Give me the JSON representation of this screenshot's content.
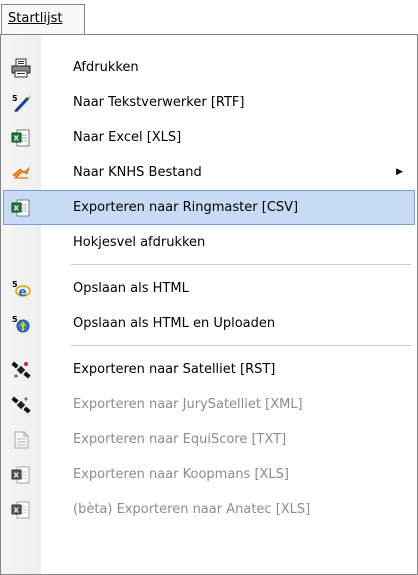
{
  "menu": {
    "title": "Startlijst"
  },
  "items": [
    {
      "label": "Afdrukken",
      "icon": "printer-icon"
    },
    {
      "label": "Naar Tekstverwerker [RTF]",
      "icon": "text-editor-icon"
    },
    {
      "label": "Naar Excel [XLS]",
      "icon": "excel-icon"
    },
    {
      "label": "Naar KNHS Bestand",
      "icon": "knhs-icon",
      "submenu_arrow": "▶"
    },
    {
      "label": "Exporteren naar Ringmaster [CSV]",
      "icon": "excel-icon",
      "state": "highlighted"
    },
    {
      "label": "Hokjesvel afdrukken"
    },
    {
      "label": "Opslaan als HTML",
      "icon": "html-ie-icon"
    },
    {
      "label": "Opslaan als HTML en Uploaden",
      "icon": "upload-html-icon"
    },
    {
      "label": "Exporteren naar Satelliet [RST]",
      "icon": "satellite-icon"
    },
    {
      "label": "Exporteren naar JurySatelliet [XML]",
      "icon": "satellite-icon",
      "state": "disabled"
    },
    {
      "label": "Exporteren naar EquiScore [TXT]",
      "icon": "document-icon",
      "state": "disabled"
    },
    {
      "label": "Exporteren naar Koopmans [XLS]",
      "icon": "excel-icon",
      "state": "disabled"
    },
    {
      "label": "(bèta) Exporteren naar Anatec [XLS]",
      "icon": "excel-icon",
      "state": "disabled"
    }
  ],
  "colors": {
    "highlight_bg": "#c7dcf4",
    "highlight_border": "#7a9fd0",
    "disabled_text": "#8c8c8c"
  }
}
